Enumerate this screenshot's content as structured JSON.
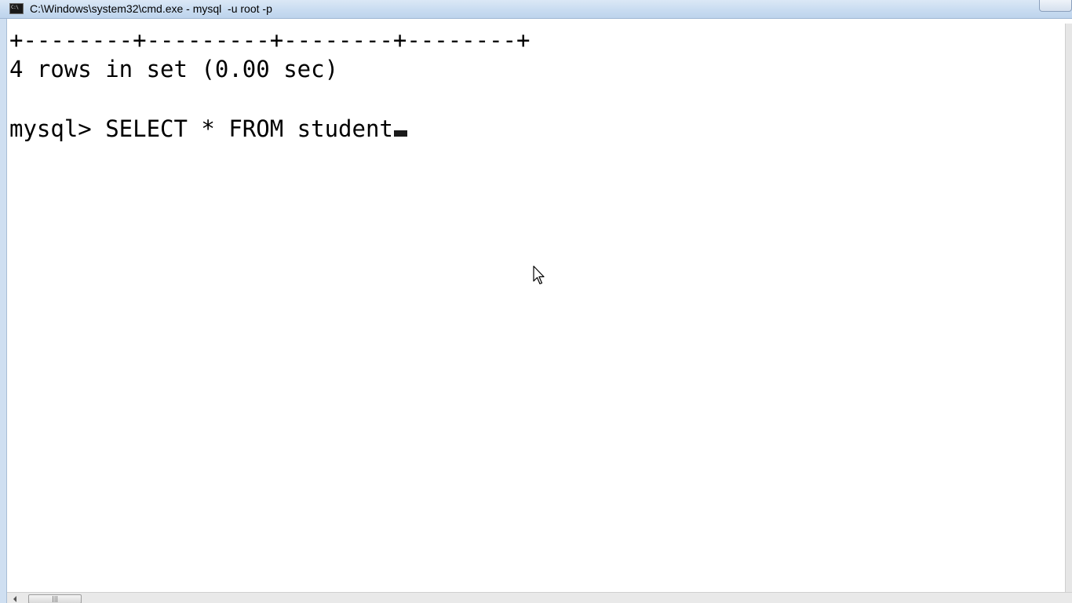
{
  "window": {
    "title": "C:\\Windows\\system32\\cmd.exe - mysql  -u root -p",
    "icon_label": "C:\\",
    "icon": "console-icon"
  },
  "console": {
    "lines": [
      "+--------+---------+--------+--------+",
      "4 rows in set (0.00 sec)",
      "",
      "mysql> SELECT * FROM student"
    ]
  },
  "scrollbar": {
    "grip": "|||"
  },
  "colors": {
    "console_background": "#ffffff",
    "console_text": "#000000",
    "titlebar": "#c9dcf1"
  }
}
